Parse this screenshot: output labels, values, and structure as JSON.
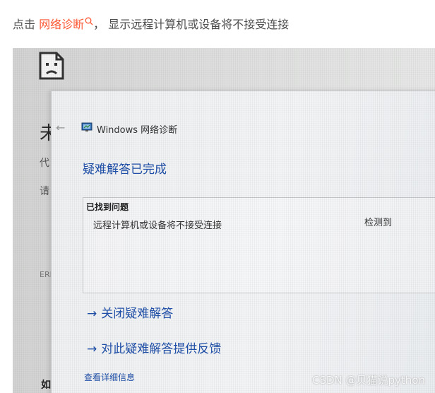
{
  "caption": {
    "prefix": "点击 ",
    "link_text": "网络诊断",
    "suffix": "， 显示远程计算机或设备将不接受连接"
  },
  "background_page": {
    "title_char": "未",
    "line1_char": "代",
    "line2_char": "请",
    "error_code_prefix": "ERI",
    "bottom_char": "如"
  },
  "dialog": {
    "title": "Windows 网络诊断",
    "heading": "疑难解答已完成",
    "problems_label": "已找到问题",
    "problem_text": "远程计算机或设备将不接受连接",
    "problem_status": "检测到",
    "close_link": "关闭疑难解答",
    "feedback_link": "对此疑难解答提供反馈",
    "details_link": "查看详细信息"
  },
  "watermark": "CSDN @贝猫说python",
  "icons": {
    "caption_search": "search-icon",
    "sad_page": "sad-page-icon",
    "back": "back-arrow-icon",
    "app": "network-diagnostics-icon",
    "link_arrow": "arrow-right-icon"
  },
  "colors": {
    "caption_link": "#fc5531",
    "dialog_link": "#1f4fa8"
  }
}
